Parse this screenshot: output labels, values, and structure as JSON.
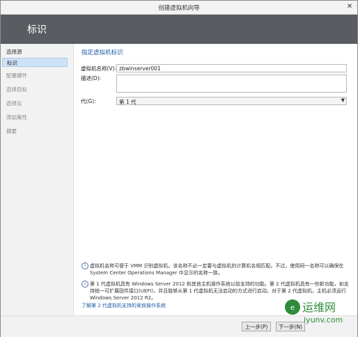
{
  "window": {
    "title": "创建虚拟机向导",
    "close_label": "✕"
  },
  "banner": {
    "title": "标识"
  },
  "sidebar": {
    "items": [
      {
        "label": "选择源",
        "state": "done"
      },
      {
        "label": "标识",
        "state": "active"
      },
      {
        "label": "配置硬件",
        "state": "pending"
      },
      {
        "label": "选择目标",
        "state": "pending"
      },
      {
        "label": "选择云",
        "state": "pending"
      },
      {
        "label": "添加属性",
        "state": "pending"
      },
      {
        "label": "摘要",
        "state": "pending"
      }
    ]
  },
  "main": {
    "section_title": "指定虚拟机标识",
    "vm_name_label": "虚拟机名称(V):",
    "vm_name_value": "zbwinserver001",
    "description_label": "描述(D):",
    "description_value": "",
    "generation_label": "代(G):",
    "generation_value": "第 1 代",
    "info1": "虚拟机名称可便于 VMM 识别虚拟机。该名称不必一定要与虚拟机的计算机名相匹配。不过，使用同一名称可以确保在 System Center Operations Manager 中显示的名称一致。",
    "info2": "第 1 代虚拟机具有 Windows Server 2012 和其他主机操作系统以前支持的功能。第 2 代虚拟机具有一些新功能，如支持统一可扩展固件接口(UEFI)，并且能够从第 1 代虚拟机无法启动的方式进行启动。对于第 2 代虚拟机，主机必须运行 Windows Server 2012 R2。",
    "link": "了解第 2 代虚拟机支持的来宾操作系统"
  },
  "footer": {
    "prev_label": "上一步(P)",
    "next_label": "下一步(N)"
  },
  "watermark": {
    "text1": "运维网",
    "text2": "iyunv.com"
  },
  "colors": {
    "banner": "#595d62",
    "active_item": "#cfe3f6",
    "link": "#1a5aa6",
    "watermark_green": "#2e8b3a"
  }
}
